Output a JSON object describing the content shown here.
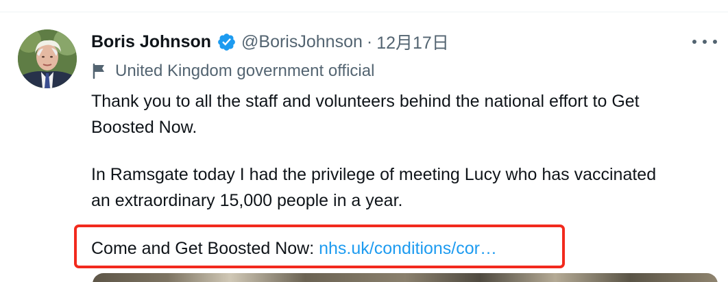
{
  "tweet": {
    "author": {
      "display_name": "Boris Johnson",
      "handle": "@BorisJohnson",
      "verified": true
    },
    "separator": "·",
    "date": "12月17日",
    "account_label": {
      "icon": "flag-icon",
      "text": "United Kingdom government official"
    },
    "body": {
      "paragraph_1_line_1": "Thank you to all the staff and volunteers behind the national effort to Get",
      "paragraph_1_line_2": "Boosted Now.",
      "paragraph_2_line_1": "In Ramsgate today I had the privilege of meeting Lucy who has vaccinated",
      "paragraph_2_line_2": "an extraordinary 15,000 people in a year.",
      "paragraph_3_text": "Come and Get Boosted Now: ",
      "paragraph_3_link": "nhs.uk/conditions/cor…"
    },
    "more_menu_icon": "more-horizontal-icon",
    "media_preview": "image-attachment"
  },
  "annotation": {
    "highlight_color": "#f22a1d"
  },
  "colors": {
    "primary_text": "#0f1419",
    "secondary_text": "#536471",
    "link": "#1d9bf0",
    "verified_badge": "#1d9bf0"
  }
}
